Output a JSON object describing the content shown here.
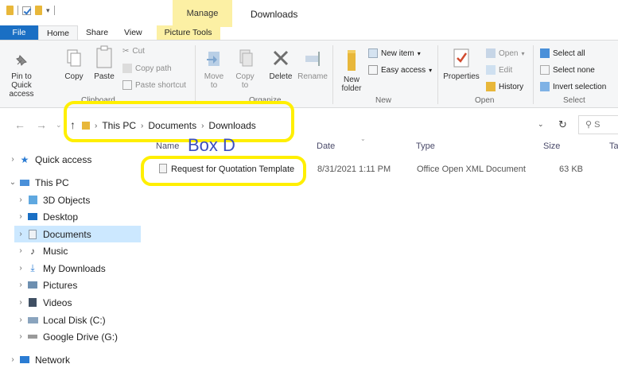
{
  "titlebar": {
    "manage_tab": "Manage",
    "window_title": "Downloads"
  },
  "tabs": {
    "file": "File",
    "home": "Home",
    "share": "Share",
    "view": "View",
    "picture_tools": "Picture Tools"
  },
  "ribbon": {
    "pin_to_quick_access": "Pin to Quick access",
    "copy": "Copy",
    "paste": "Paste",
    "cut": "Cut",
    "copy_path": "Copy path",
    "paste_shortcut": "Paste shortcut",
    "clipboard_group": "Clipboard",
    "move_to": "Move to",
    "copy_to": "Copy to",
    "delete": "Delete",
    "rename": "Rename",
    "organize_group": "Organize",
    "new_folder": "New folder",
    "new_item": "New item",
    "easy_access": "Easy access",
    "new_group": "New",
    "properties": "Properties",
    "open": "Open",
    "edit": "Edit",
    "history": "History",
    "open_group": "Open",
    "select_all": "Select all",
    "select_none": "Select none",
    "invert_selection": "Invert selection",
    "select_group": "Select"
  },
  "address": {
    "crumbs": [
      "This PC",
      "Documents",
      "Downloads"
    ],
    "search_placeholder": "S"
  },
  "columns": {
    "name": "Name",
    "date": "Date",
    "type": "Type",
    "size": "Size",
    "tags": "Ta"
  },
  "annotation": {
    "label": "Box D",
    "color": "#ffef00"
  },
  "files": [
    {
      "name": "Request for Quotation Template",
      "date": "8/31/2021 1:11 PM",
      "type": "Office Open XML Document",
      "size": "63 KB"
    }
  ],
  "nav": {
    "quick_access": "Quick access",
    "this_pc": "This PC",
    "objects_3d": "3D Objects",
    "desktop": "Desktop",
    "documents": "Documents",
    "music": "Music",
    "my_downloads": "My Downloads",
    "pictures": "Pictures",
    "videos": "Videos",
    "local_disk": "Local Disk (C:)",
    "google_drive": "Google Drive (G:)",
    "network": "Network"
  },
  "colors": {
    "accent": "#1a6fc4",
    "manage_highlight": "#fcf0a4",
    "selection": "#cce8ff",
    "annotation_text": "#3b4ec0"
  }
}
